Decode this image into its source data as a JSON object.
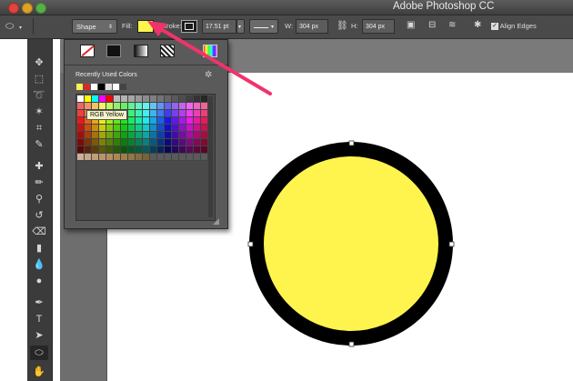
{
  "window": {
    "title": "Adobe Photoshop CC"
  },
  "optionsbar": {
    "mode": "Shape",
    "fill_label": "Fill:",
    "stroke_label": "Stroke:",
    "stroke_size": "17.51 pt",
    "w_label": "W:",
    "w_value": "304 px",
    "link_icon": "link-icon",
    "h_label": "H:",
    "h_value": "304 px",
    "align_edges_label": "Align Edges",
    "align_edges_checked": true,
    "fill_color": "#fff44d",
    "stroke_color": "#000000"
  },
  "color_panel": {
    "recent_label": "Recently Used Colors",
    "tooltip": "RGB Yellow",
    "recent_colors": [
      "#fff44d",
      "#d42c2c",
      "#ffffff",
      "#000000",
      "#e0e0e0",
      "#ffffff",
      "#444444"
    ]
  },
  "tools": [
    "move-tool",
    "marquee-tool",
    "lasso-tool",
    "magic-wand-tool",
    "crop-tool",
    "eyedropper-tool",
    "spot-healing-tool",
    "brush-tool",
    "clone-stamp-tool",
    "history-brush-tool",
    "eraser-tool",
    "gradient-tool",
    "blur-tool",
    "dodge-tool",
    "pen-tool",
    "type-tool",
    "path-selection-tool",
    "ellipse-tool",
    "hand-tool"
  ],
  "canvas": {
    "shape": "ellipse",
    "fill": "#fff44d",
    "stroke": "#000000"
  }
}
